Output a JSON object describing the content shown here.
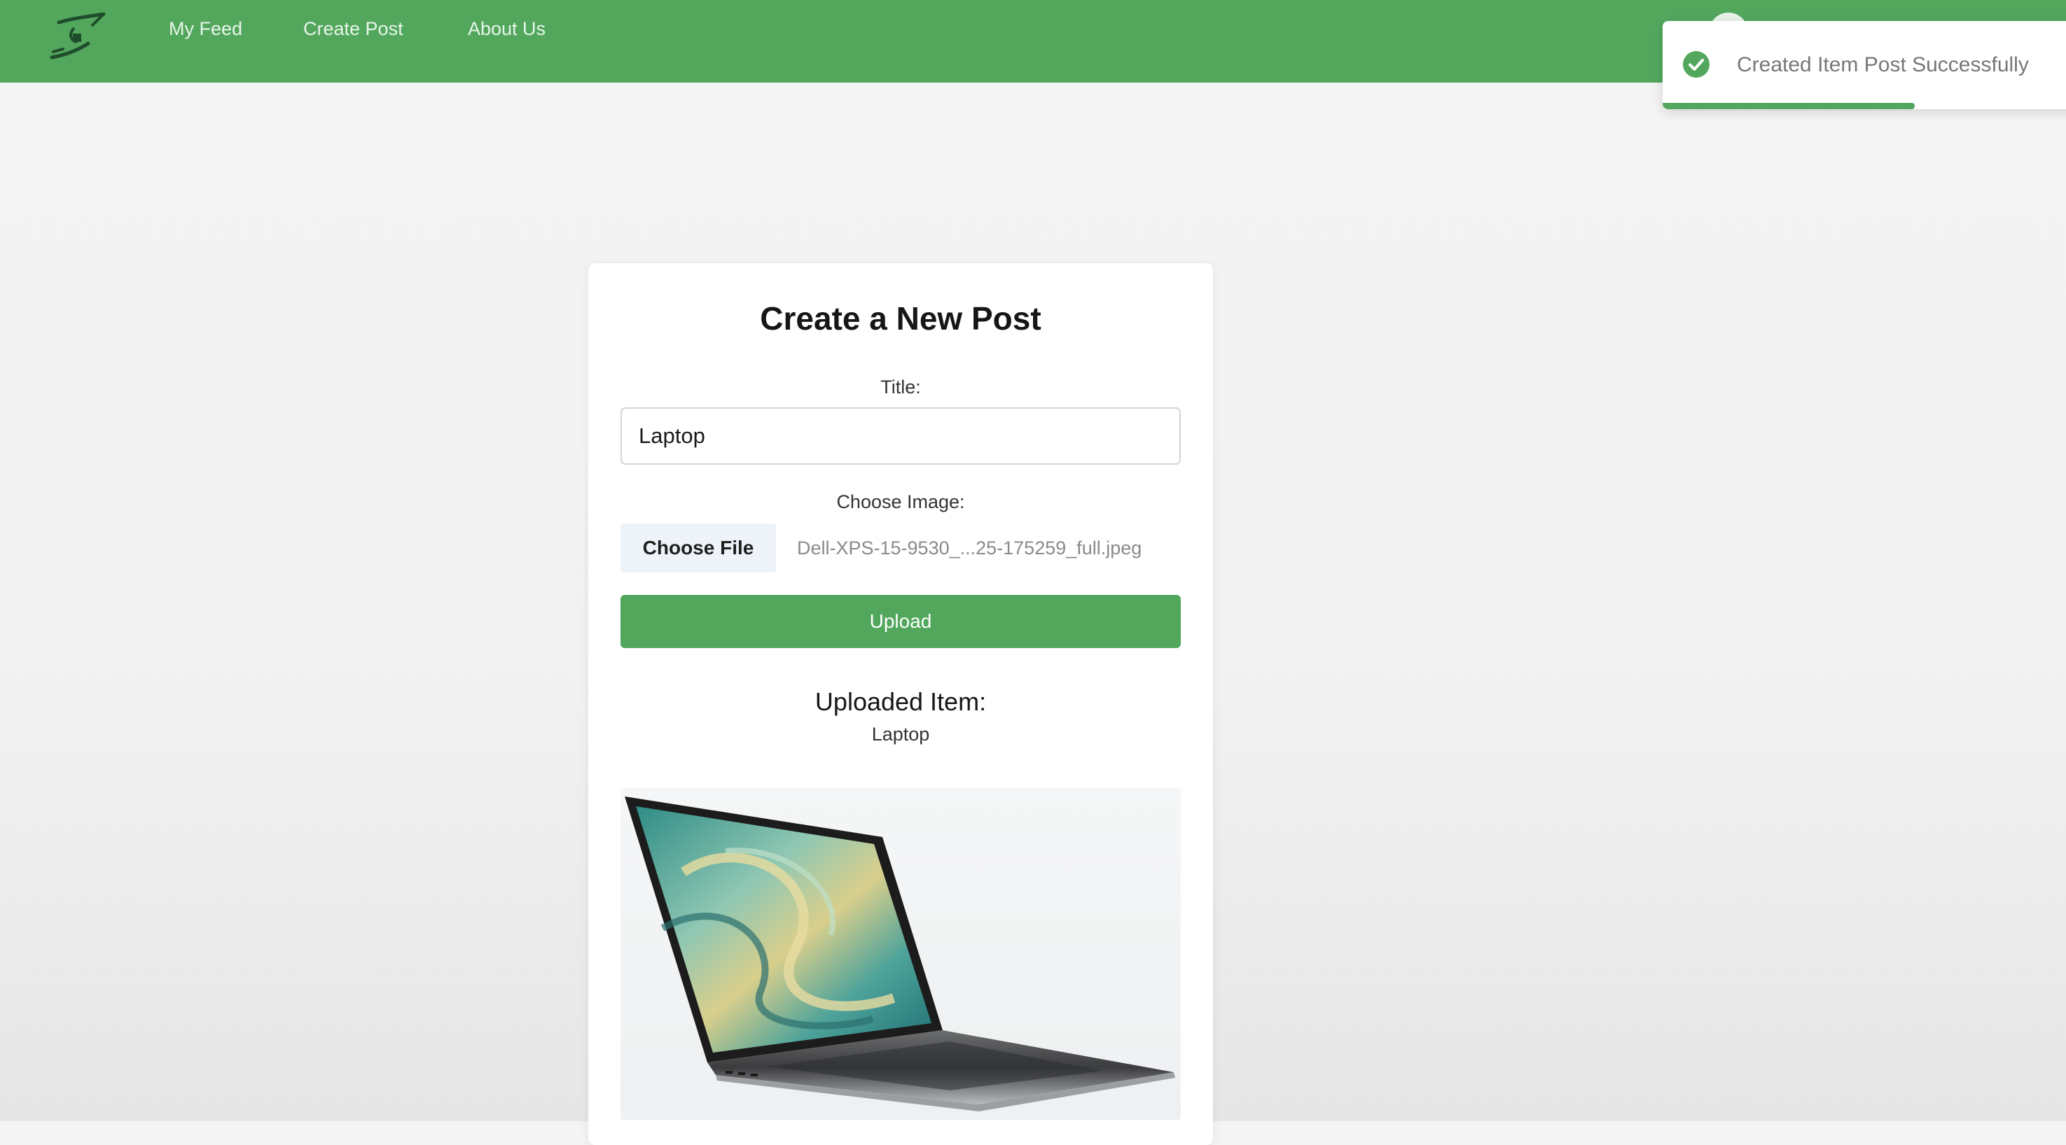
{
  "nav": {
    "links": [
      "My Feed",
      "Create Post",
      "About Us"
    ]
  },
  "toast": {
    "message": "Created Item Post Successfully",
    "progress_fraction": 0.6
  },
  "form": {
    "heading": "Create a New Post",
    "title_label": "Title:",
    "title_value": "Laptop",
    "image_label": "Choose Image:",
    "choose_file_label": "Choose File",
    "file_name": "Dell-XPS-15-9530_...25-175259_full.jpeg",
    "upload_label": "Upload"
  },
  "uploaded": {
    "heading": "Uploaded Item:",
    "item_name": "Laptop"
  },
  "icons": {
    "logo": "hands-logo-icon",
    "toast": "check-circle-icon",
    "image": "laptop-image"
  },
  "colors": {
    "brand_green": "#52a75d",
    "nav_link": "#e9f5ea",
    "toast_text": "#777777"
  }
}
